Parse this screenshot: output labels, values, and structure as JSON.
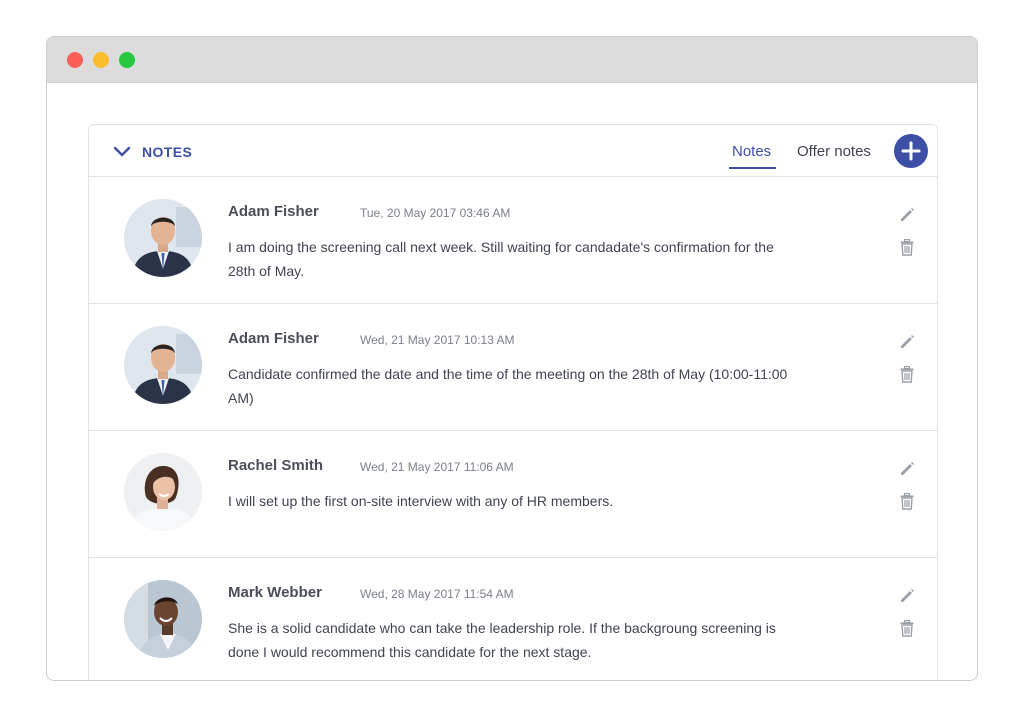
{
  "window": {
    "controls": [
      "close",
      "minimize",
      "maximize"
    ]
  },
  "panel": {
    "title": "NOTES",
    "collapse_icon": "chevron-down-icon",
    "tabs": [
      {
        "label": "Notes",
        "active": true
      },
      {
        "label": "Offer notes",
        "active": false
      }
    ],
    "add_icon": "plus-icon"
  },
  "notes": [
    {
      "author": "Adam Fisher",
      "date": "Tue, 20 May 2017 03:46 AM",
      "text": "I am doing the screening call next week. Still waiting for candadate's confirmation for the 28th of May.",
      "avatar": "man-suit-avatar"
    },
    {
      "author": "Adam Fisher",
      "date": "Wed, 21 May 2017 10:13 AM",
      "text": "Candidate confirmed the date and the time of the meeting on the 28th of May (10:00-11:00 AM)",
      "avatar": "man-suit-avatar"
    },
    {
      "author": "Rachel Smith",
      "date": "Wed, 21 May 2017 11:06 AM",
      "text": "I will set up the first on-site interview with any of HR members.",
      "avatar": "woman-avatar"
    },
    {
      "author": "Mark Webber",
      "date": "Wed, 28 May 2017 11:54 AM",
      "text": "She is a solid candidate who can take the leadership role. If the backgroung screening is done I would recommend this candidate for the next stage.",
      "avatar": "man-laughing-avatar"
    }
  ],
  "colors": {
    "accent": "#3e4fa6",
    "border": "#dfe1e5",
    "icon": "#9aa0a8"
  }
}
